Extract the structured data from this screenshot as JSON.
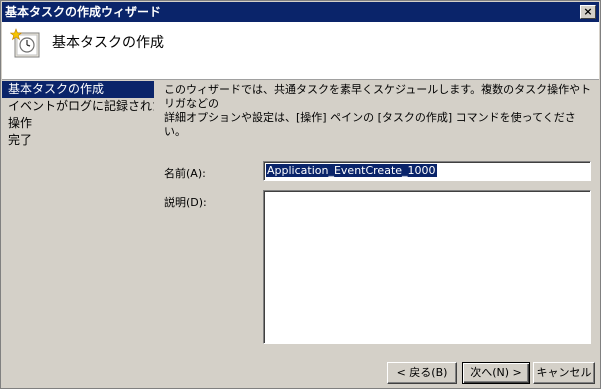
{
  "window": {
    "title": "基本タスクの作成ウィザード",
    "close_icon": "close-icon"
  },
  "header": {
    "title": "基本タスクの作成",
    "icon": "task-clock-icon"
  },
  "nav": {
    "items": [
      {
        "label": "基本タスクの作成",
        "active": true
      },
      {
        "label": "イベントがログに記録されたとき",
        "active": false
      },
      {
        "label": "操作",
        "active": false
      },
      {
        "label": "完了",
        "active": false
      }
    ]
  },
  "main": {
    "description_line1": "このウィザードでは、共通タスクを素早くスケジュールします。複数のタスク操作やトリガなどの",
    "description_line2": "詳細オプションや設定は、[操作] ペインの [タスクの作成] コマンドを使ってください。",
    "name_label": "名前(A):",
    "name_value": "Application_EventCreate_1000",
    "desc_label": "説明(D):",
    "desc_value": ""
  },
  "buttons": {
    "back": "< 戻る(B)",
    "next": "次へ(N) >",
    "cancel": "キャンセル"
  },
  "colors": {
    "titlebar": "#0a246a",
    "face": "#d4d0c8",
    "selection": "#0a246a"
  }
}
